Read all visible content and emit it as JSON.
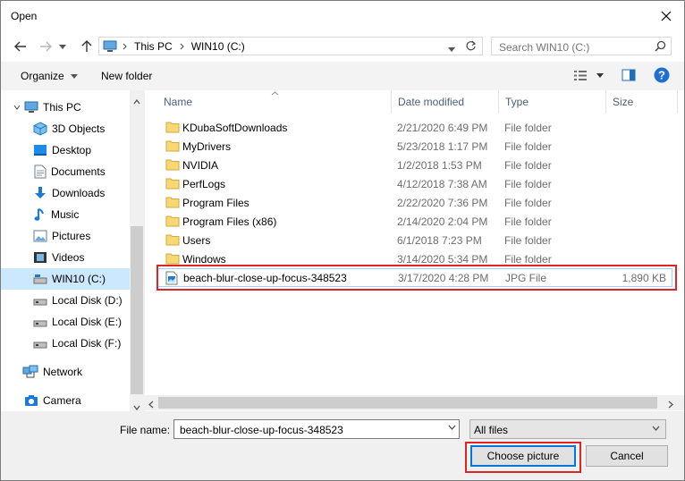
{
  "window": {
    "title": "Open"
  },
  "address": {
    "segments": [
      "This PC",
      "WIN10 (C:)"
    ]
  },
  "search": {
    "placeholder": "Search WIN10 (C:)"
  },
  "toolbar": {
    "organize_label": "Organize",
    "new_folder_label": "New folder"
  },
  "sidebar": {
    "items": [
      {
        "label": "This PC",
        "icon": "computer-icon"
      },
      {
        "label": "3D Objects",
        "icon": "3d-objects-icon"
      },
      {
        "label": "Desktop",
        "icon": "desktop-icon"
      },
      {
        "label": "Documents",
        "icon": "documents-icon"
      },
      {
        "label": "Downloads",
        "icon": "downloads-icon"
      },
      {
        "label": "Music",
        "icon": "music-icon"
      },
      {
        "label": "Pictures",
        "icon": "pictures-icon"
      },
      {
        "label": "Videos",
        "icon": "videos-icon"
      },
      {
        "label": "WIN10 (C:)",
        "icon": "drive-icon",
        "selected": true
      },
      {
        "label": "Local Disk (D:)",
        "icon": "drive-icon"
      },
      {
        "label": "Local Disk (E:)",
        "icon": "drive-icon"
      },
      {
        "label": "Local Disk (F:)",
        "icon": "drive-icon"
      },
      {
        "label": "Network",
        "icon": "network-icon"
      },
      {
        "label": "Camera",
        "icon": "camera-icon"
      }
    ]
  },
  "columns": {
    "name": "Name",
    "date": "Date modified",
    "type": "Type",
    "size": "Size"
  },
  "files": [
    {
      "name": "KDubaSoftDownloads",
      "date": "2/21/2020 6:49 PM",
      "type": "File folder",
      "size": "",
      "icon": "folder-icon"
    },
    {
      "name": "MyDrivers",
      "date": "5/23/2018 1:17 PM",
      "type": "File folder",
      "size": "",
      "icon": "folder-icon"
    },
    {
      "name": "NVIDIA",
      "date": "1/2/2018 1:53 PM",
      "type": "File folder",
      "size": "",
      "icon": "folder-icon"
    },
    {
      "name": "PerfLogs",
      "date": "4/12/2018 7:38 AM",
      "type": "File folder",
      "size": "",
      "icon": "folder-icon"
    },
    {
      "name": "Program Files",
      "date": "2/22/2020 7:36 PM",
      "type": "File folder",
      "size": "",
      "icon": "folder-icon"
    },
    {
      "name": "Program Files (x86)",
      "date": "2/14/2020 2:04 PM",
      "type": "File folder",
      "size": "",
      "icon": "folder-icon"
    },
    {
      "name": "Users",
      "date": "6/1/2018 7:23 PM",
      "type": "File folder",
      "size": "",
      "icon": "folder-icon"
    },
    {
      "name": "Windows",
      "date": "3/14/2020 5:34 PM",
      "type": "File folder",
      "size": "",
      "icon": "folder-icon"
    },
    {
      "name": "beach-blur-close-up-focus-348523",
      "date": "3/17/2020 4:28 PM",
      "type": "JPG File",
      "size": "1,890 KB",
      "icon": "image-file-icon"
    }
  ],
  "footer": {
    "filename_label": "File name:",
    "filename_value": "beach-blur-close-up-focus-348523",
    "filter_value": "All files",
    "choose_label": "Choose picture",
    "cancel_label": "Cancel"
  },
  "colors": {
    "accent": "#0078d7",
    "highlight": "#e02424",
    "selected_bg": "#cce8ff",
    "folder": "#f8d775"
  }
}
